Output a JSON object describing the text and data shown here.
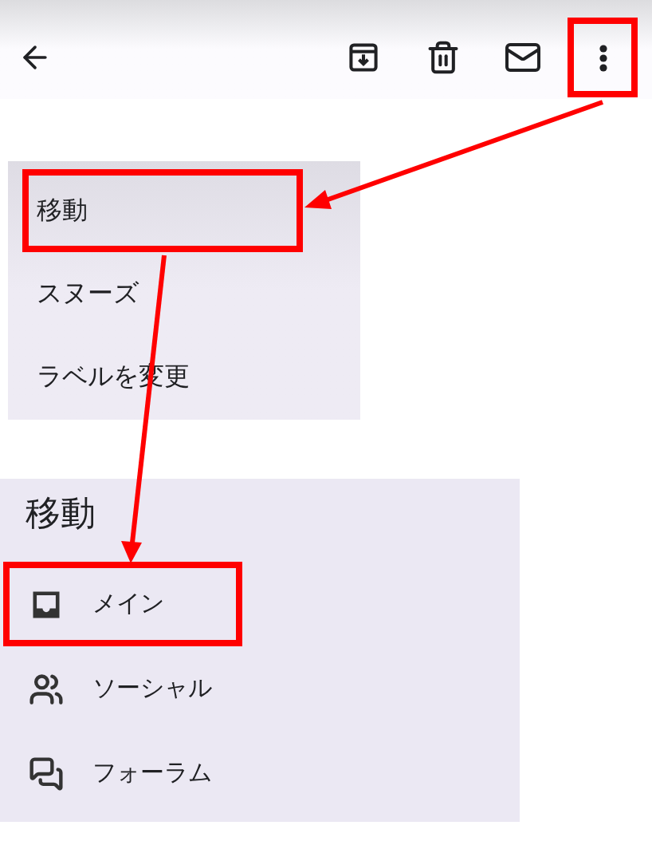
{
  "toolbar": {
    "buttons": [
      {
        "kind": "back",
        "highlighted": false
      },
      {
        "kind": "archive",
        "highlighted": false
      },
      {
        "kind": "delete",
        "highlighted": false
      },
      {
        "kind": "mail",
        "highlighted": false
      },
      {
        "kind": "more",
        "highlighted": true
      }
    ]
  },
  "menu": {
    "items": [
      {
        "label": "移動",
        "highlighted": true
      },
      {
        "label": "スヌーズ",
        "highlighted": false
      },
      {
        "label": "ラベルを変更",
        "highlighted": false
      }
    ]
  },
  "move_sheet": {
    "title": "移動",
    "items": [
      {
        "kind": "inbox",
        "label": "メイン",
        "highlighted": true
      },
      {
        "kind": "people",
        "label": "ソーシャル",
        "highlighted": false
      },
      {
        "kind": "forum",
        "label": "フォーラム",
        "highlighted": false
      }
    ]
  }
}
